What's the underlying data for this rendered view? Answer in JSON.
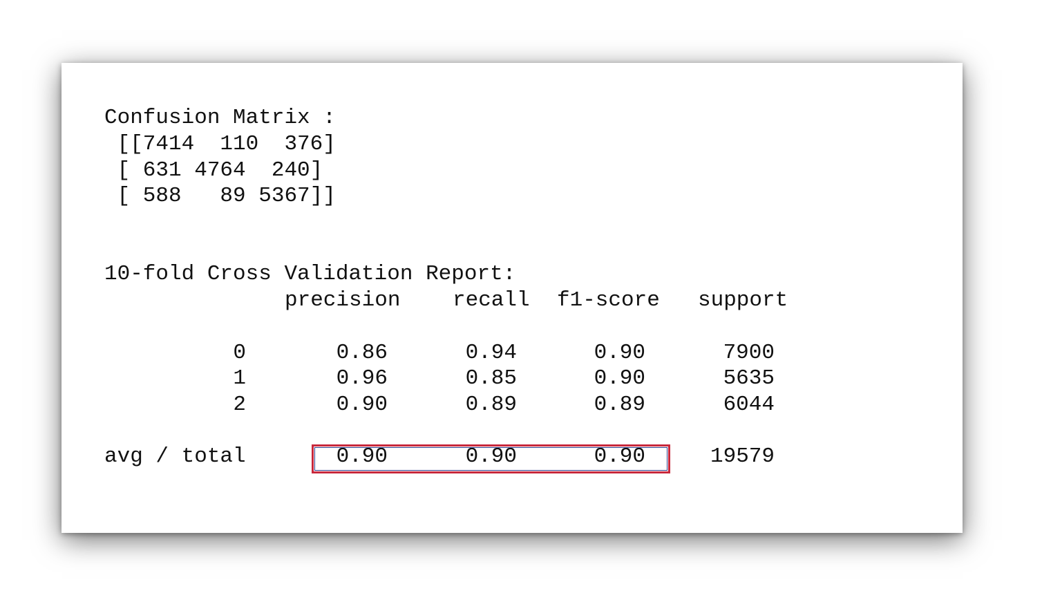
{
  "confusion_matrix": {
    "title": "Confusion Matrix :",
    "rows": [
      " [[7414  110  376]",
      " [ 631 4764  240]",
      " [ 588   89 5367]]"
    ]
  },
  "report": {
    "title": "10-fold Cross Validation Report:",
    "headers": [
      "precision",
      "recall",
      "f1-score",
      "support"
    ],
    "rows": [
      {
        "label": "0",
        "precision": "0.86",
        "recall": "0.94",
        "f1": "0.90",
        "support": "7900"
      },
      {
        "label": "1",
        "precision": "0.96",
        "recall": "0.85",
        "f1": "0.90",
        "support": "5635"
      },
      {
        "label": "2",
        "precision": "0.90",
        "recall": "0.89",
        "f1": "0.89",
        "support": "6044"
      }
    ],
    "avg": {
      "label": "avg / total",
      "precision": "0.90",
      "recall": "0.90",
      "f1": "0.90",
      "support": "19579"
    }
  },
  "colors": {
    "highlight_border": "#c8283c"
  }
}
